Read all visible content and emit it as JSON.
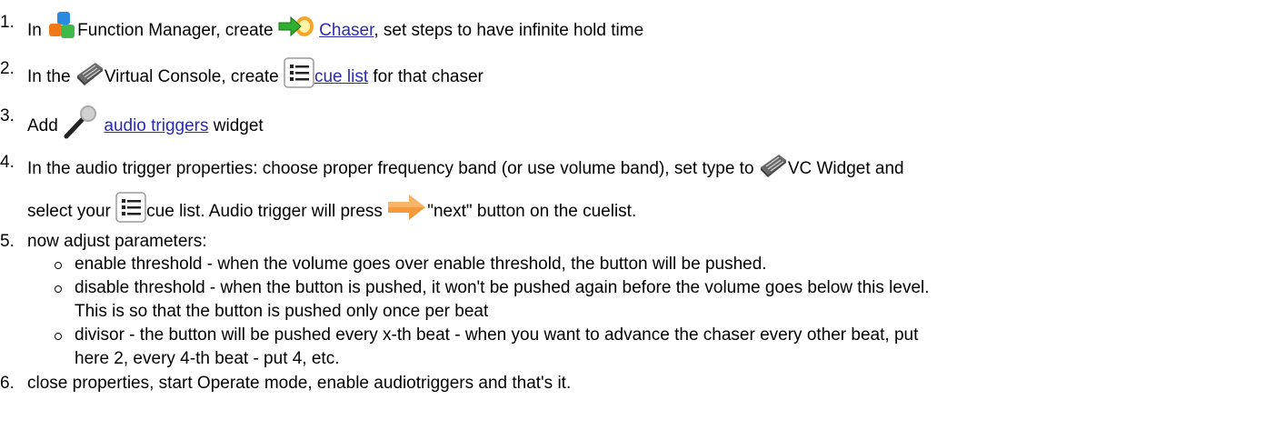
{
  "steps": [
    {
      "num": "1.",
      "parts": {
        "a": "In",
        "b": "Function Manager, create",
        "link": "Chaser",
        "c": ", set steps to have infinite hold time"
      },
      "icons": [
        "function-manager-icon",
        "chaser-icon"
      ]
    },
    {
      "num": "2.",
      "parts": {
        "a": "In the",
        "b": "Virtual Console, create",
        "link": "cue list",
        "c": "for that chaser"
      },
      "icons": [
        "virtual-console-icon",
        "cue-list-icon"
      ]
    },
    {
      "num": "3.",
      "parts": {
        "a": "Add",
        "link": "audio triggers",
        "c": "widget"
      },
      "icons": [
        "microphone-icon"
      ]
    },
    {
      "num": "4.",
      "parts": {
        "a": "In the audio trigger properties: choose proper frequency band (or use volume band), set type to",
        "b": "VC Widget and",
        "c": "select your",
        "d": "cue list. Audio trigger will press",
        "e": "\"next\" button on the cuelist."
      },
      "icons": [
        "virtual-console-icon",
        "cue-list-icon",
        "next-arrow-icon"
      ]
    },
    {
      "num": "5.",
      "text": "now adjust parameters:",
      "sub": [
        {
          "l1": "enable threshold - when the volume goes over enable threshold, the button will be pushed."
        },
        {
          "l1": "disable threshold - when the button is pushed, it won't be pushed again before the volume goes below this level.",
          "l2": "This is so that the button is pushed only once per beat"
        },
        {
          "l1": "divisor - the button will be pushed every x-th beat - when you want to advance the chaser every other beat, put",
          "l2": "here 2, every 4-th beat - put 4, etc."
        }
      ]
    },
    {
      "num": "6.",
      "text": "close properties, start Operate mode, enable audiotriggers and that's it."
    }
  ],
  "colors": {
    "link": "#2b2bb0",
    "text": "#000000",
    "arrow": "#f29a3c"
  }
}
